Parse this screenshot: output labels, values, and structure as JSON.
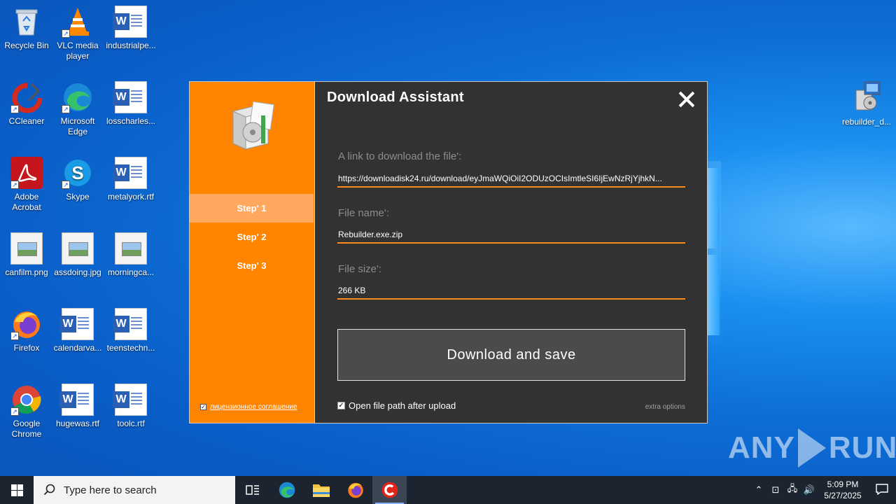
{
  "desktop": {
    "icons": [
      {
        "label": "Recycle Bin"
      },
      {
        "label": "VLC media player"
      },
      {
        "label": "industrialpe..."
      },
      {
        "label": "CCleaner"
      },
      {
        "label": "Microsoft Edge"
      },
      {
        "label": "losscharles..."
      },
      {
        "label": "Adobe Acrobat"
      },
      {
        "label": "Skype"
      },
      {
        "label": "metalyork.rtf"
      },
      {
        "label": "canfilm.png"
      },
      {
        "label": "assdoing.jpg"
      },
      {
        "label": "morningca..."
      },
      {
        "label": "Firefox"
      },
      {
        "label": "calendarva..."
      },
      {
        "label": "teenstechn..."
      },
      {
        "label": "Google Chrome"
      },
      {
        "label": "hugewas.rtf"
      },
      {
        "label": "toolc.rtf"
      },
      {
        "label": "rebuilder_d..."
      }
    ]
  },
  "dialog": {
    "title": "Download Assistant",
    "steps": [
      "Step' 1",
      "Step' 2",
      "Step' 3"
    ],
    "active_step": 0,
    "license_label": "лицензионное соглашение",
    "fields": {
      "link_label": "A link to download the file':",
      "link_value": "https://downloadisk24.ru/download/eyJmaWQiOiI2ODUzOCIsImtleSI6IjEwNzRjYjhkN...",
      "name_label": "File name':",
      "name_value": "Rebuilder.exe.zip",
      "size_label": "File size':",
      "size_value": "266 KB"
    },
    "download_button": "Download and save",
    "open_path_label": "Open file path after upload",
    "open_path_checked": true,
    "extra_options": "extra options",
    "colors": {
      "sidebar": "#ff8400",
      "main": "#323232",
      "accent": "#ff8c1a"
    }
  },
  "watermark": {
    "text_left": "ANY",
    "text_right": "RUN"
  },
  "taskbar": {
    "search_placeholder": "Type here to search",
    "time": "5:09 PM",
    "date": "5/27/2025"
  }
}
